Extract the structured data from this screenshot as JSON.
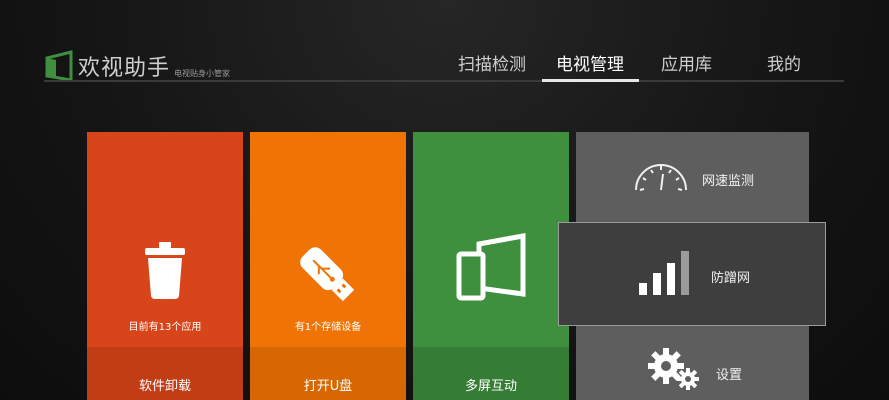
{
  "app": {
    "title": "欢视助手",
    "subtitle": "电视贴身小管家",
    "logo_icon": "tv-screen-icon"
  },
  "nav": {
    "tabs": [
      {
        "label": "扫描检测"
      },
      {
        "label": "电视管理",
        "active": true
      },
      {
        "label": "应用库"
      },
      {
        "label": "我的"
      }
    ]
  },
  "tiles": [
    {
      "label": "软件卸载",
      "status": "目前有13个应用",
      "icon": "trash-icon",
      "color": "#d9451b",
      "bottom_color": "#c23c15"
    },
    {
      "label": "打开U盘",
      "status": "有1个存储设备",
      "icon": "usb-drive-icon",
      "color": "#ef7405",
      "bottom_color": "#d66703"
    },
    {
      "label": "多屏互动",
      "icon": "multi-screen-icon",
      "color": "#3e8f3e",
      "bottom_color": "#357c35"
    }
  ],
  "panel": {
    "items": [
      {
        "label": "网速监测",
        "icon": "speedometer-icon"
      },
      {
        "label": "防蹭网",
        "icon": "signal-bars-icon"
      },
      {
        "label": "设置",
        "icon": "gear-icon"
      }
    ]
  }
}
